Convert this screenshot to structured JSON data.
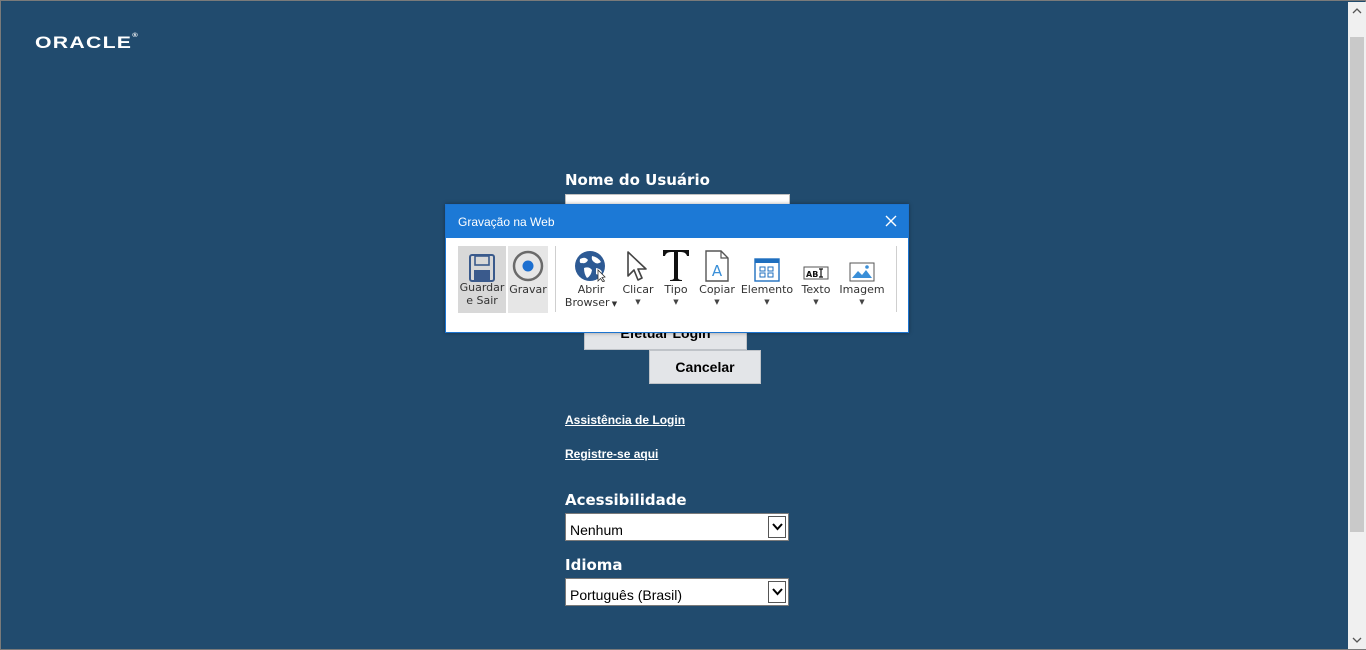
{
  "logo": {
    "text": "ORACLE",
    "trademark": "®"
  },
  "login": {
    "username_label": "Nome do Usuário",
    "username_value": "",
    "login_button_label": "Efetuar Login",
    "cancel_button_label": "Cancelar",
    "login_help_link": "Assistência de Login",
    "register_link": "Registre-se aqui",
    "accessibility_label": "Acessibilidade",
    "accessibility_value": "Nenhum",
    "language_label": "Idioma",
    "language_value": "Português (Brasil)"
  },
  "recorder": {
    "title": "Gravação na Web",
    "tools": {
      "save_exit_line1": "Guardar",
      "save_exit_line2": "e Sair",
      "record": "Gravar",
      "open_browser_line1": "Abrir",
      "open_browser_line2": "Browser",
      "click": "Clicar",
      "type": "Tipo",
      "copy": "Copiar",
      "element": "Elemento",
      "text": "Texto",
      "image": "Imagem"
    },
    "icons": [
      "floppy-disk-icon",
      "record-icon",
      "globe-icon",
      "cursor-icon",
      "type-icon",
      "copy-document-icon",
      "element-grid-icon",
      "text-field-icon",
      "image-icon",
      "close-icon"
    ]
  },
  "colors": {
    "background": "#214b6e",
    "recorder_titlebar": "#1c79d6",
    "button_bg": "#e3e5e8"
  }
}
